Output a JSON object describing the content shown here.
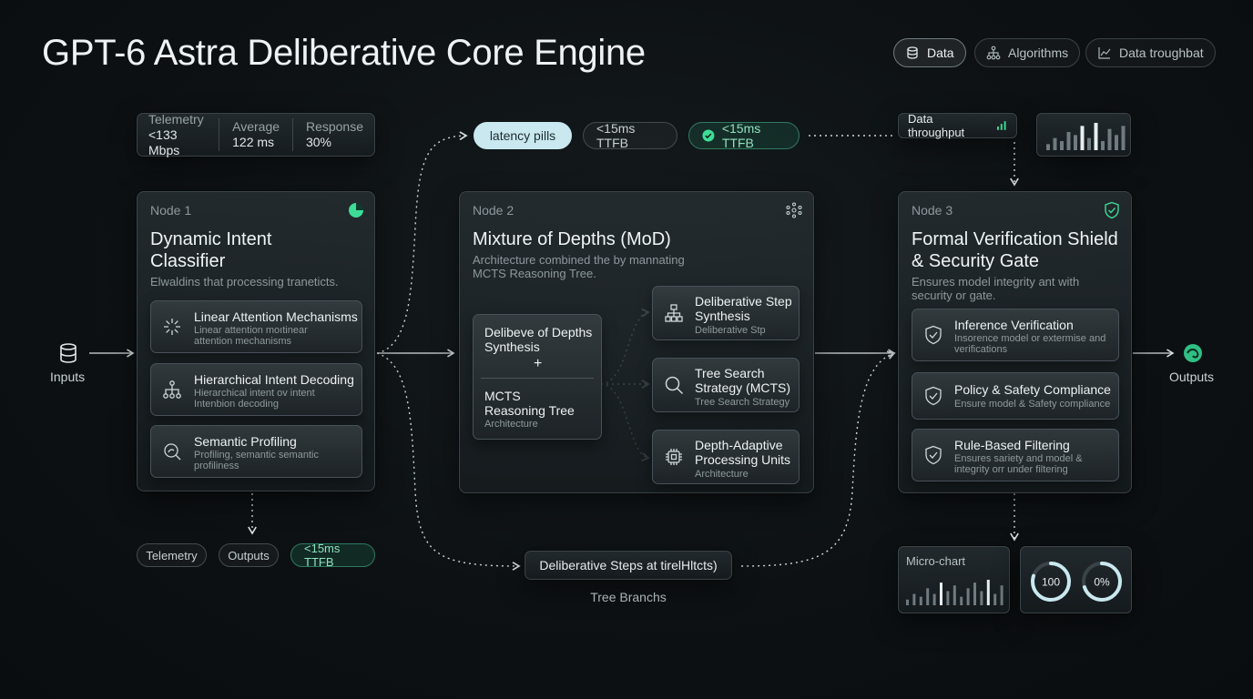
{
  "title": "GPT-6 Astra Deliberative Core Engine",
  "tabs": [
    {
      "label": "Data",
      "icon": "database-icon",
      "active": true
    },
    {
      "label": "Algorithms",
      "icon": "hierarchy-icon",
      "active": false
    },
    {
      "label": "Data troughbat",
      "icon": "line-chart-icon",
      "active": false
    }
  ],
  "telemetry": {
    "items": [
      {
        "key": "Telemetry",
        "value": "<133 Mbps"
      },
      {
        "key": "Average",
        "value": "122 ms"
      },
      {
        "key": "Response",
        "value": "30%"
      }
    ]
  },
  "latency_pills": [
    "latency pills",
    "<15ms TTFB",
    "<15ms TTFB"
  ],
  "throughput_label": "Data throughput",
  "inputs_label": "Inputs",
  "outputs_label": "Outputs",
  "node1": {
    "label": "Node 1",
    "title_line1": "Dynamic Intent",
    "title_line2": "Classifier",
    "subtitle": "Elwaldins that processing traneticts.",
    "cards": [
      {
        "title": "Linear Attention Mechanisms",
        "sub1": "Linear attention moıtinear",
        "sub2": "attention mechanisms",
        "icon": "burst-icon"
      },
      {
        "title": "Hierarchical Intent Decoding",
        "sub1": "Hierarchical intent ov intent",
        "sub2": "Intenbion decoding",
        "icon": "hierarchy-icon"
      },
      {
        "title": "Semantic Profiling",
        "sub1": "Profiling, semantic semantic",
        "sub2": "profiliness",
        "icon": "profile-search-icon"
      }
    ]
  },
  "node1_bottom": [
    "Telemetry",
    "Outputs",
    "<15ms TTFB"
  ],
  "node2": {
    "label": "Node 2",
    "title": "Mixture of Depths (MoD)",
    "sub1": "Architecture combined the by mannating",
    "sub2": "MCTS Reasoning Tree.",
    "inner": {
      "top_line1": "Delibeve of Depths",
      "top_line2": "Synthesis",
      "plus": "+",
      "bottom_line1": "MCTS",
      "bottom_line2": "Reasoning Tree",
      "bottom_sub": "Architecture"
    },
    "cards": [
      {
        "title1": "Deliberative Step",
        "title2": "Synthesis",
        "sub": "Deliberative Stp",
        "icon": "hierarchy-icon"
      },
      {
        "title1": "Tree Search",
        "title2": "Strategy (MCTS)",
        "sub": "Tree Search Strategy",
        "icon": "search-icon"
      },
      {
        "title1": "Depth-Adaptive",
        "title2": "Processing Units",
        "sub": "Architecture",
        "icon": "chip-icon"
      }
    ]
  },
  "node3": {
    "label": "Node 3",
    "title_line1": "Formal Verification Shield",
    "title_line2": "& Security Gate",
    "sub1": "Ensures model integrity ant with",
    "sub2": "security or gate.",
    "cards": [
      {
        "title": "Inference Verification",
        "sub1": "Insorence model or extermise and",
        "sub2": "verifications",
        "icon": "shield-check-icon"
      },
      {
        "title": "Policy & Safety Compliance",
        "sub1": "Ensure model & Safety compliance",
        "sub2": "",
        "icon": "shield-check-icon"
      },
      {
        "title": "Rule-Based Filtering",
        "sub1": "Ensures sariety and model &",
        "sub2": "integrity orr under filtering",
        "icon": "shield-check-icon"
      }
    ]
  },
  "tree_box": "Deliberative Steps at tirelHltcts)",
  "tree_caption": "Tree Branchs",
  "micro_chart_label": "Micro-chart",
  "gauges": [
    {
      "label": "100",
      "fraction": 0.8
    },
    {
      "label": "0%",
      "fraction": 0.7
    }
  ],
  "colors": {
    "accent_green": "#3ddc97",
    "accent_light": "#c9e8f0",
    "background": "#0d1113"
  },
  "chart_data": [
    {
      "type": "bar",
      "name": "throughput-sparkbars",
      "values": [
        2,
        4,
        3,
        6,
        5,
        8,
        4,
        9,
        3,
        7,
        5,
        8
      ]
    },
    {
      "type": "bar",
      "name": "micro-chart-bars",
      "values": [
        2,
        4,
        3,
        6,
        4,
        8,
        5,
        7,
        3,
        6,
        8,
        5,
        9,
        4,
        7
      ]
    }
  ]
}
